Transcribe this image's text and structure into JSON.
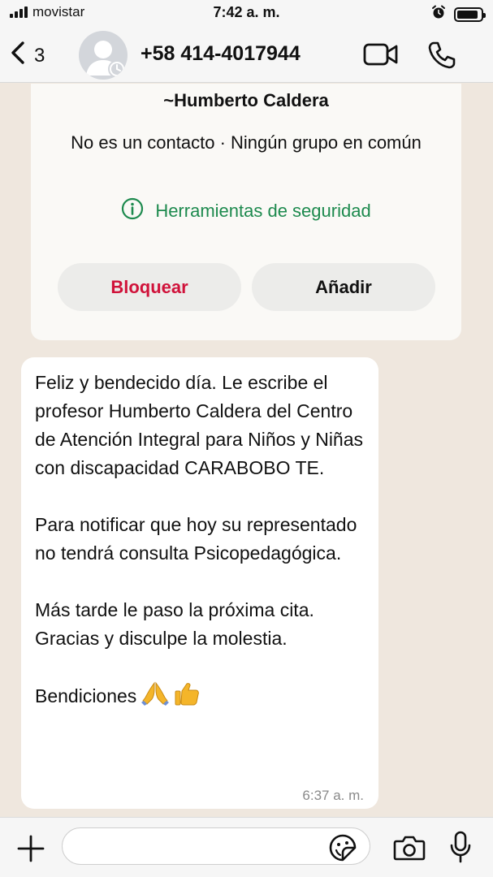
{
  "status_bar": {
    "carrier": "movistar",
    "time": "7:42 a. m.",
    "battery_level": 0.9,
    "icons": [
      "signal-icon",
      "alarm-icon",
      "battery-icon"
    ]
  },
  "nav": {
    "back_count": "3",
    "contact_phone": "+58 414-4017944",
    "icons": [
      "back-chevron-icon",
      "avatar-icon",
      "video-call-icon",
      "phone-call-icon"
    ]
  },
  "info_card": {
    "name": "~Humberto Caldera",
    "subtitle": "No es un contacto · Ningún grupo en común",
    "security_label": "Herramientas de seguridad",
    "block_label": "Bloquear",
    "add_label": "Añadir"
  },
  "message": {
    "paragraphs": [
      "Feliz y bendecido día. Le escribe el profesor Humberto Caldera del Centro de Atención Integral para Niños y Niñas con discapacidad CARABOBO TE.",
      "Para notificar que hoy su representado no tendrá consulta Psicopedagógica.",
      "Más tarde le paso la próxima cita. Gracias y disculpe la molestia.",
      "Bendiciones"
    ],
    "emojis": [
      "praying-hands-emoji",
      "thumbs-up-emoji"
    ],
    "time": "6:37 a. m."
  },
  "input_bar": {
    "placeholder": "",
    "icons": [
      "plus-icon",
      "sticker-icon",
      "camera-icon",
      "microphone-icon"
    ]
  },
  "colors": {
    "accent_green": "#1d8a4e",
    "block_red": "#d0123a",
    "chat_background": "#efe7de",
    "bubble": "#ffffff"
  }
}
